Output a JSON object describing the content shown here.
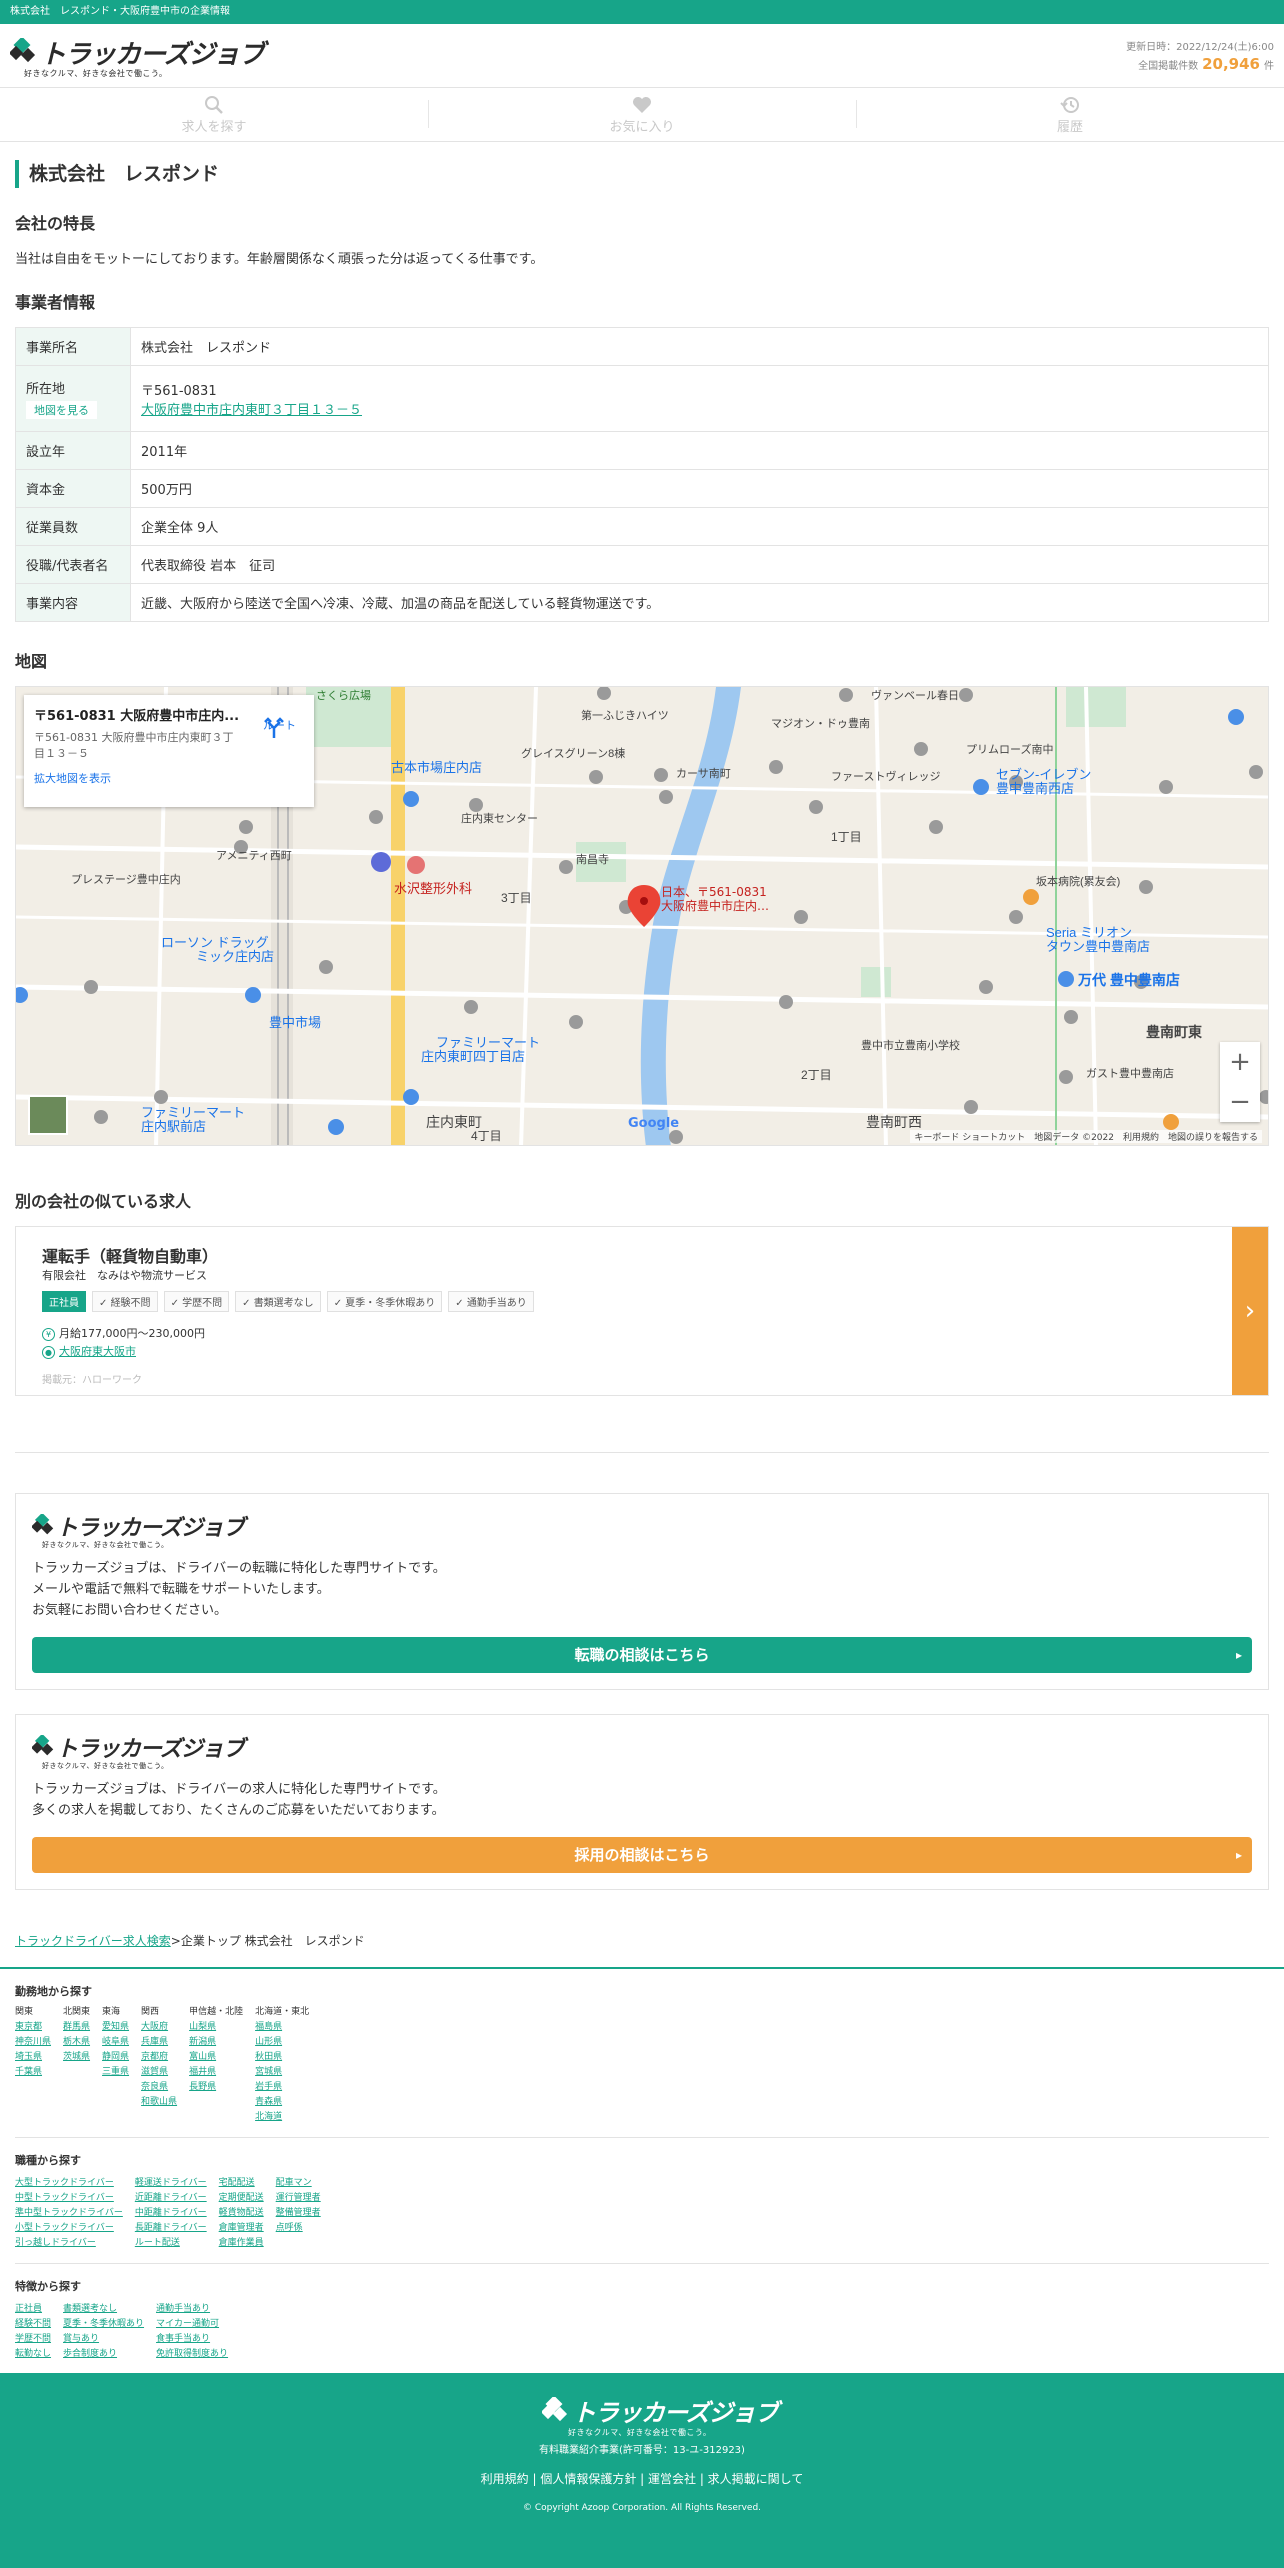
{
  "topbar": {
    "text": "株式会社　レスポンド・大阪府豊中市の企業情報"
  },
  "header": {
    "logo_text": "トラッカーズジョブ",
    "logo_tagline": "好きなクルマ、好きな会社で働こう。",
    "updated_label": "更新日時：2022/12/24(土)6:00",
    "total_label": "全国掲載件数",
    "total_count": "20,946",
    "total_unit": "件"
  },
  "nav": {
    "search": "求人を探す",
    "favorite": "お気に入り",
    "history": "履歴"
  },
  "company": {
    "name": "株式会社　レスポンド",
    "feature_heading": "会社の特長",
    "feature_text": "当社は自由をモットーにしております。年齢層関係なく頑張った分は返ってくる仕事です。",
    "info_heading": "事業者情報",
    "rows": [
      {
        "key": "事業所名",
        "value": "株式会社　レスポンド"
      },
      {
        "key": "所在地",
        "value": "〒561-0831",
        "link": "大阪府豊中市庄内東町３丁目１３－５",
        "button": "地図を見る"
      },
      {
        "key": "設立年",
        "value": "2011年"
      },
      {
        "key": "資本金",
        "value": "500万円"
      },
      {
        "key": "従業員数",
        "value": "企業全体 9人"
      },
      {
        "key": "役職/代表者名",
        "value": "代表取締役 岩本　征司"
      },
      {
        "key": "事業内容",
        "value": "近畿、大阪府から陸送で全国へ冷凍、冷蔵、加温の商品を配送している軽貨物運送です。"
      }
    ]
  },
  "map": {
    "heading": "地図",
    "card_title": "〒561-0831 大阪府豊中市庄内...",
    "card_address": "〒561-0831 大阪府豊中市庄内東町３丁目１３－５",
    "route": "ルート",
    "enlarge": "拡大地図を表示",
    "pin_label_1": "日本、〒561-0831",
    "pin_label_2": "大阪府豊中市庄内…",
    "footer": "キーボード ショートカット　地図データ ©2022　利用規約　地図の誤りを報告する",
    "google": "Google",
    "places": [
      {
        "name": "さくら広場"
      },
      {
        "name": "第一ふじきハイツ"
      },
      {
        "name": "ヴァンベール春日"
      },
      {
        "name": "マジオン・ドゥ豊南"
      },
      {
        "name": "プリムローズ南中"
      },
      {
        "name": "グレイスグリーン8棟"
      },
      {
        "name": "カーサ南町"
      },
      {
        "name": "ファーストヴィレッジ"
      },
      {
        "name": "セブン-イレブン 豊中豊南西店"
      },
      {
        "name": "古本市場庄内店"
      },
      {
        "name": "庄内東センター"
      },
      {
        "name": "水沢整形外科"
      },
      {
        "name": "南昌寺"
      },
      {
        "name": "アメニティ西町"
      },
      {
        "name": "プレステージ豊中庄内"
      },
      {
        "name": "ローソン ドラッグミック庄内店"
      },
      {
        "name": "ファミリーマート 庄内東町四丁目店"
      },
      {
        "name": "ファミリーマート 庄内駅前店"
      },
      {
        "name": "豊中市場"
      },
      {
        "name": "万代 豊中豊南店"
      },
      {
        "name": "豊南町東"
      },
      {
        "name": "豊南町西"
      },
      {
        "name": "庄内東町"
      },
      {
        "name": "Seria ミリオンタウン豊中豊南店"
      },
      {
        "name": "坂本病院(累友会)"
      },
      {
        "name": "豊中市立豊南小学校"
      },
      {
        "name": "ガスト豊中豊南店"
      },
      {
        "name": "1丁目"
      },
      {
        "name": "2丁目"
      },
      {
        "name": "3丁目"
      },
      {
        "name": "4丁目"
      }
    ]
  },
  "similar": {
    "heading": "別の会社の似ている求人",
    "title": "運転手（軽貨物自動車）",
    "company": "有限会社　なみはや物流サービス",
    "tags": [
      "正社員",
      "経験不問",
      "学歴不問",
      "書類選考なし",
      "夏季・冬季休暇あり",
      "通勤手当あり"
    ],
    "salary": "月給177,000円〜230,000円",
    "location": "大阪府東大阪市",
    "source": "掲載元：ハローワーク"
  },
  "promo1": {
    "lines": [
      "トラッカーズジョブは、ドライバーの転職に特化した専門サイトです。",
      "メールや電話で無料で転職をサポートいたします。",
      "お気軽にお問い合わせください。"
    ],
    "button": "転職の相談はこちら"
  },
  "promo2": {
    "lines": [
      "トラッカーズジョブは、ドライバーの求人に特化した専門サイトです。",
      "多くの求人を掲載しており、たくさんのご応募をいただいております。"
    ],
    "button": "採用の相談はこちら"
  },
  "breadcrumb": {
    "link": "トラックドライバー求人検索",
    "rest": ">企業トップ 株式会社　レスポンド"
  },
  "area": {
    "heading": "勤務地から探す",
    "columns": [
      {
        "label": "関東",
        "items": [
          "東京都",
          "神奈川県",
          "埼玉県",
          "千葉県"
        ]
      },
      {
        "label": "北関東",
        "items": [
          "群馬県",
          "栃木県",
          "茨城県"
        ]
      },
      {
        "label": "東海",
        "items": [
          "愛知県",
          "岐阜県",
          "静岡県",
          "三重県"
        ]
      },
      {
        "label": "関西",
        "items": [
          "大阪府",
          "兵庫県",
          "京都府",
          "滋賀県",
          "奈良県",
          "和歌山県"
        ]
      },
      {
        "label": "甲信越・北陸",
        "items": [
          "山梨県",
          "新潟県",
          "富山県",
          "福井県",
          "長野県"
        ]
      },
      {
        "label": "北海道・東北",
        "items": [
          "福島県",
          "山形県",
          "秋田県",
          "宮城県",
          "岩手県",
          "青森県",
          "北海道"
        ]
      }
    ]
  },
  "jobtype": {
    "heading": "職種から探す",
    "columns": [
      [
        "大型トラックドライバー",
        "中型トラックドライバー",
        "準中型トラックドライバー",
        "小型トラックドライバー",
        "引っ越しドライバー"
      ],
      [
        "軽運送ドライバー",
        "近距離ドライバー",
        "中距離ドライバー",
        "長距離ドライバー",
        "ルート配送"
      ],
      [
        "宅配配送",
        "定期便配送",
        "軽貨物配送",
        "倉庫管理者",
        "倉庫作業員"
      ],
      [
        "配車マン",
        "運行管理者",
        "整備管理者",
        "点呼係"
      ]
    ]
  },
  "features": {
    "heading": "特徴から探す",
    "columns": [
      [
        "正社員",
        "経験不問",
        "学歴不問",
        "転勤なし"
      ],
      [
        "書類選考なし",
        "夏季・冬季休暇あり",
        "賞与あり",
        "歩合制度あり"
      ],
      [
        "通勤手当あり",
        "マイカー通勤可",
        "食事手当あり",
        "免許取得制度あり"
      ]
    ]
  },
  "footer": {
    "logo_text": "トラッカーズジョブ",
    "logo_tagline": "好きなクルマ、好きな会社で働こう。",
    "license": "有料職業紹介事業(許可番号：13-ユ-312923)",
    "links": "利用規約 | 個人情報保護方針 | 運営会社 | 求人掲載に関して",
    "copyright": "© Copyright Azoop Corporation. All Rights Reserved."
  },
  "colors": {
    "brand": "#17a589",
    "accent": "#f0a03c"
  }
}
